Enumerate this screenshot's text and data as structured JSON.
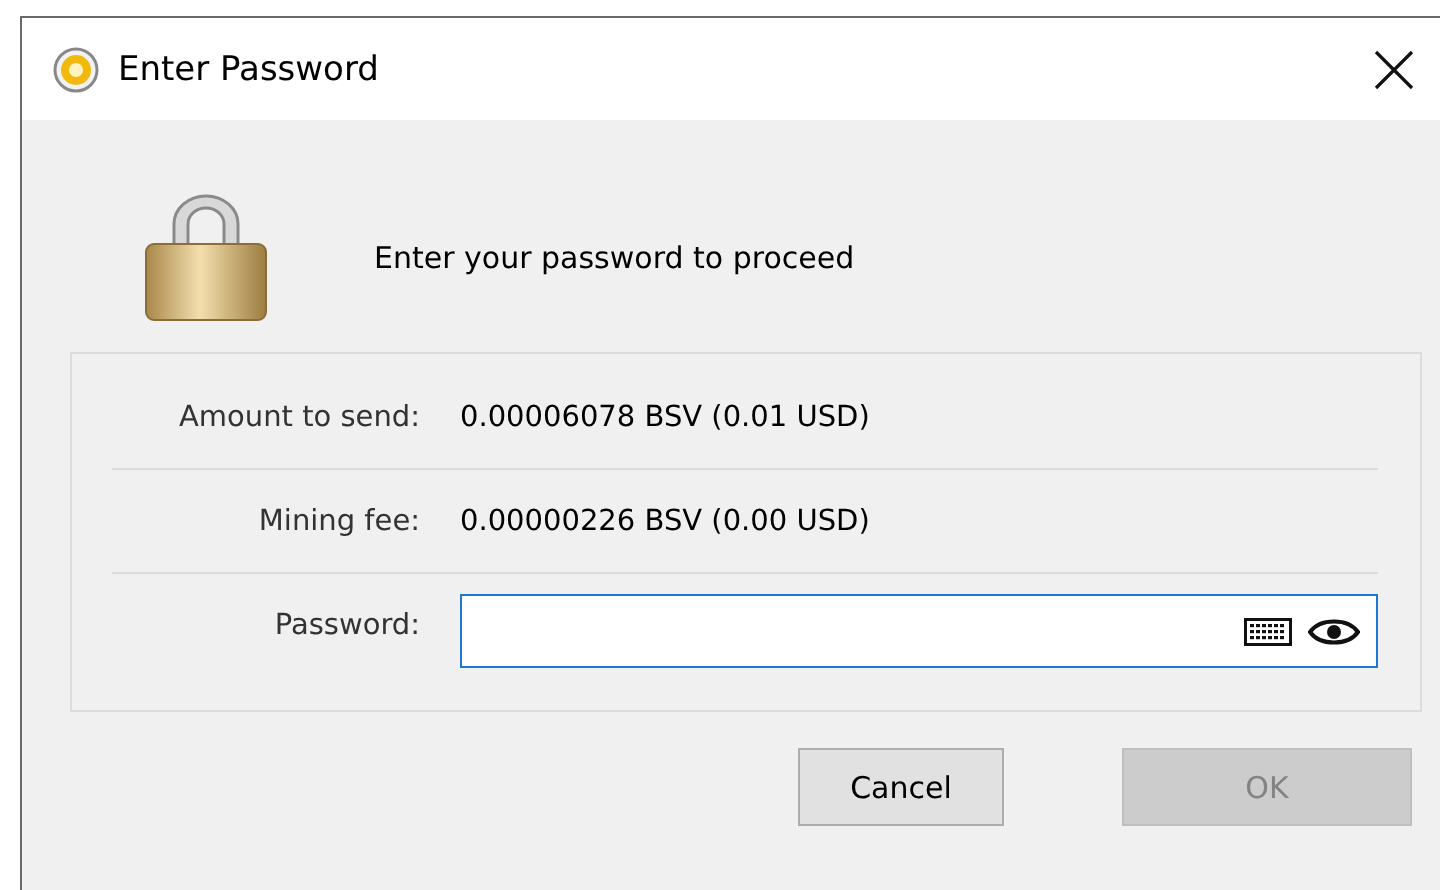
{
  "window": {
    "title": "Enter Password"
  },
  "message": "Enter your password to proceed",
  "details": [
    {
      "label": "Amount to send:",
      "value": "0.00006078 BSV (0.01 USD)"
    },
    {
      "label": "Mining fee:",
      "value": "0.00000226 BSV (0.00 USD)"
    }
  ],
  "password": {
    "label": "Password:",
    "focused": true
  },
  "buttons": [
    {
      "label": "Cancel",
      "disabled": false
    },
    {
      "label": "OK",
      "disabled": true
    }
  ]
}
